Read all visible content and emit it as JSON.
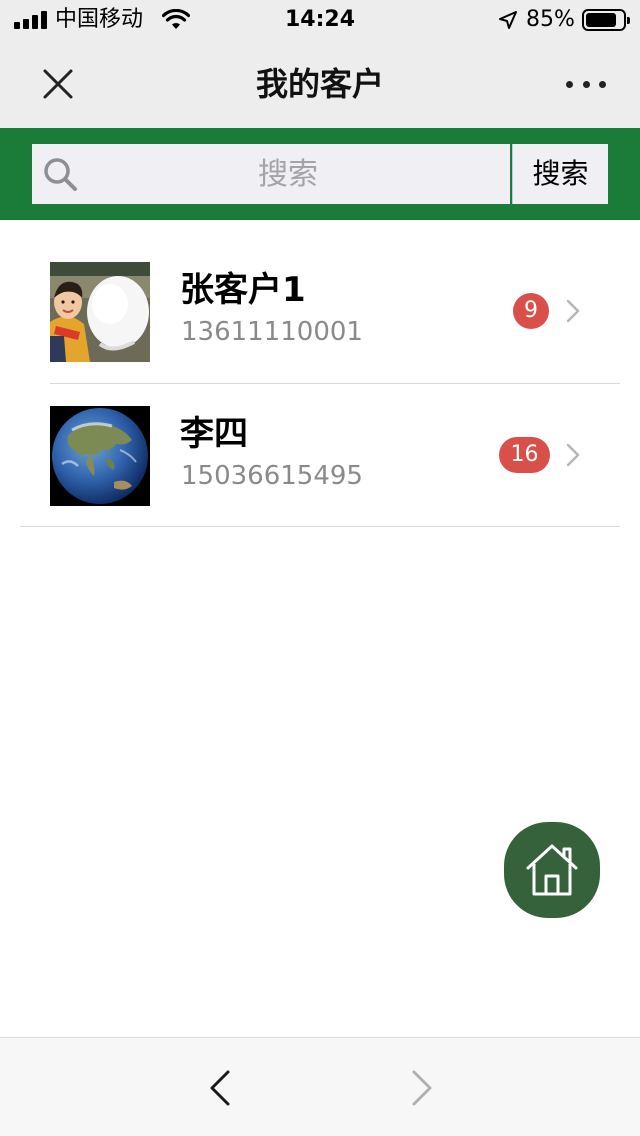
{
  "status_bar": {
    "carrier": "中国移动",
    "time": "14:24",
    "battery_percent": "85%",
    "battery_level": 0.85,
    "icons": [
      "signal-icon",
      "wifi-icon",
      "location-arrow-icon",
      "battery-icon"
    ]
  },
  "nav": {
    "title": "我的客户",
    "close_icon": "close-icon",
    "more_icon": "more-dots-icon"
  },
  "search": {
    "placeholder": "搜索",
    "value": "",
    "button_label": "搜索",
    "icon": "search-icon",
    "strip_color": "#1b7c3a"
  },
  "customers": [
    {
      "name": "张客户1",
      "phone": "13611110001",
      "badge": "9",
      "avatar": "child-with-cotton-candy-photo"
    },
    {
      "name": "李四",
      "phone": "15036615495",
      "badge": "16",
      "avatar": "earth-globe-photo"
    }
  ],
  "colors": {
    "badge": "#d94f4a",
    "home_button": "#35623a",
    "phone_text": "#8a8a8a"
  },
  "home_button": {
    "icon": "home-icon"
  },
  "bottom_bar": {
    "back_icon": "chevron-left-icon",
    "forward_icon": "chevron-right-icon"
  }
}
